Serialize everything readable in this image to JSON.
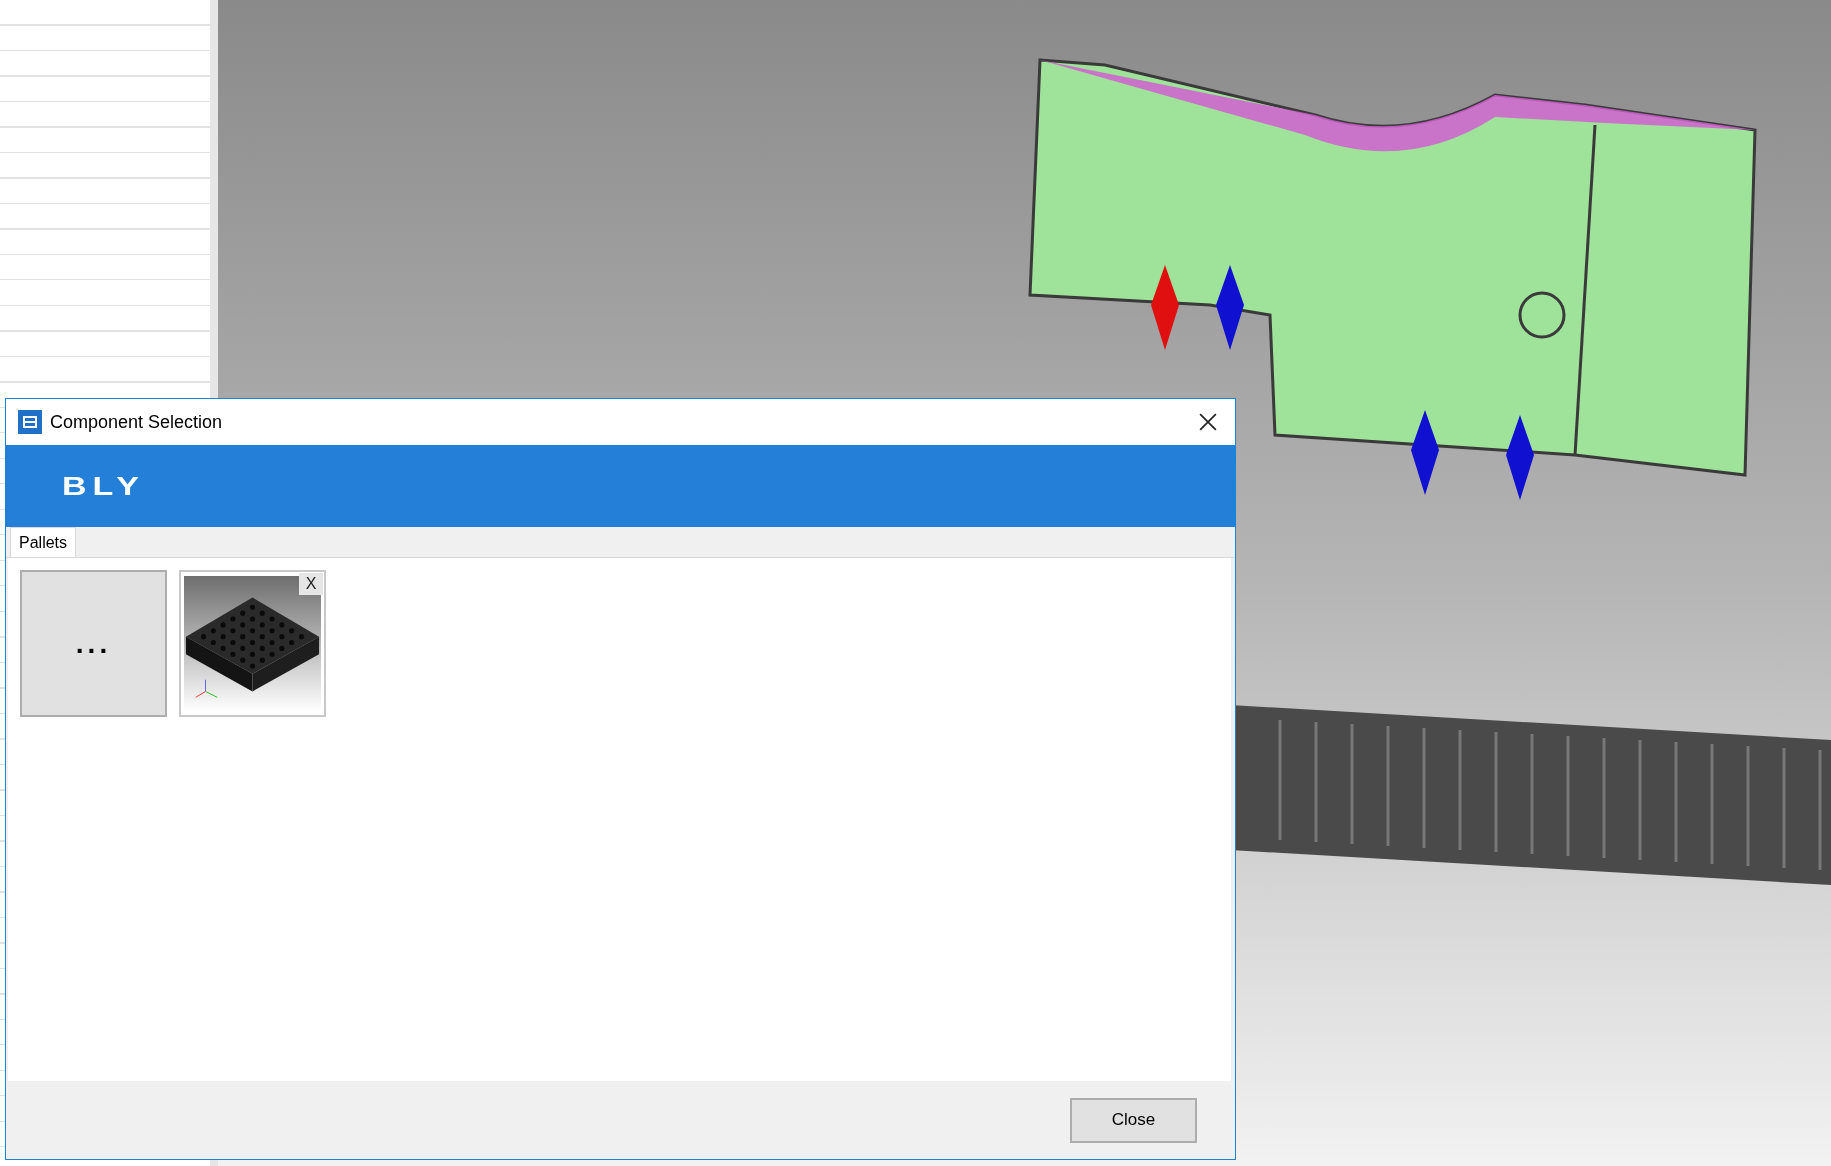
{
  "dialog": {
    "title": "Component Selection",
    "logo": "BLY",
    "tabs": [
      {
        "label": "Pallets",
        "selected": true
      }
    ],
    "tiles": [
      {
        "kind": "browse",
        "label": "..."
      },
      {
        "kind": "pallet",
        "remove": "X"
      }
    ],
    "buttons": [
      "Close"
    ]
  }
}
